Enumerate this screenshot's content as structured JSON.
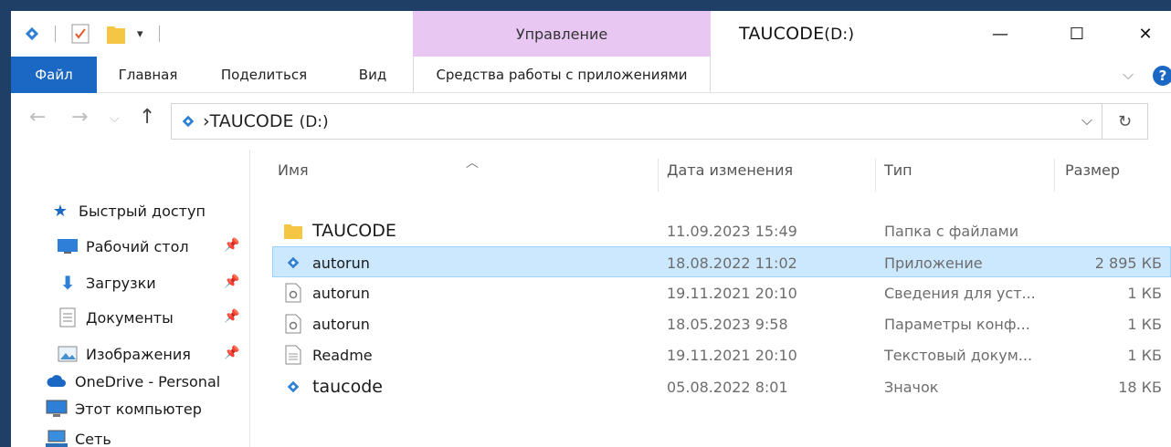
{
  "window": {
    "title": "TAUCODE",
    "title_drive": "(D:)",
    "context_group": "Управление",
    "minimize": "—",
    "maximize": "☐",
    "close": "✕"
  },
  "ribbon": {
    "tabs": [
      "Файл",
      "Главная",
      "Поделиться",
      "Вид"
    ],
    "context_tab": "Средства работы с приложениями",
    "help": "?",
    "accent_color": "#1b67c4",
    "context_color": "#e8c7f3"
  },
  "address": {
    "path": "TAUCODE",
    "drive": "(D:)",
    "separator": "›"
  },
  "navigation": {
    "quick_access": "Быстрый доступ",
    "items": [
      {
        "label": "Рабочий стол",
        "icon": "desktop-icon",
        "pinned": true
      },
      {
        "label": "Загрузки",
        "icon": "download-icon",
        "pinned": true
      },
      {
        "label": "Документы",
        "icon": "documents-icon",
        "pinned": true
      },
      {
        "label": "Изображения",
        "icon": "pictures-icon",
        "pinned": true
      }
    ],
    "onedrive": "OneDrive - Personal",
    "computer": "Этот компьютер",
    "network": "Сеть"
  },
  "files": {
    "columns": [
      "Имя",
      "Дата изменения",
      "Тип",
      "Размер"
    ],
    "rows": [
      {
        "name": "TAUCODE",
        "date": "11.09.2023 15:49",
        "type": "Папка с файлами",
        "size": "",
        "icon": "folder-icon",
        "selected": false
      },
      {
        "name": "autorun",
        "date": "18.08.2022 11:02",
        "type": "Приложение",
        "size": "2 895 КБ",
        "icon": "app-icon",
        "selected": true
      },
      {
        "name": "autorun",
        "date": "19.11.2021 20:10",
        "type": "Сведения для уст...",
        "size": "1 КБ",
        "icon": "settings-file-icon",
        "selected": false
      },
      {
        "name": "autorun",
        "date": "18.05.2023 9:58",
        "type": "Параметры конф...",
        "size": "1 КБ",
        "icon": "config-file-icon",
        "selected": false
      },
      {
        "name": "Readme",
        "date": "19.11.2021 20:10",
        "type": "Текстовый докум...",
        "size": "1 КБ",
        "icon": "text-file-icon",
        "selected": false
      },
      {
        "name": "taucode",
        "date": "05.08.2022 8:01",
        "type": "Значок",
        "size": "18 КБ",
        "icon": "app-icon",
        "selected": false
      }
    ],
    "selection_color": "#cce8ff"
  }
}
